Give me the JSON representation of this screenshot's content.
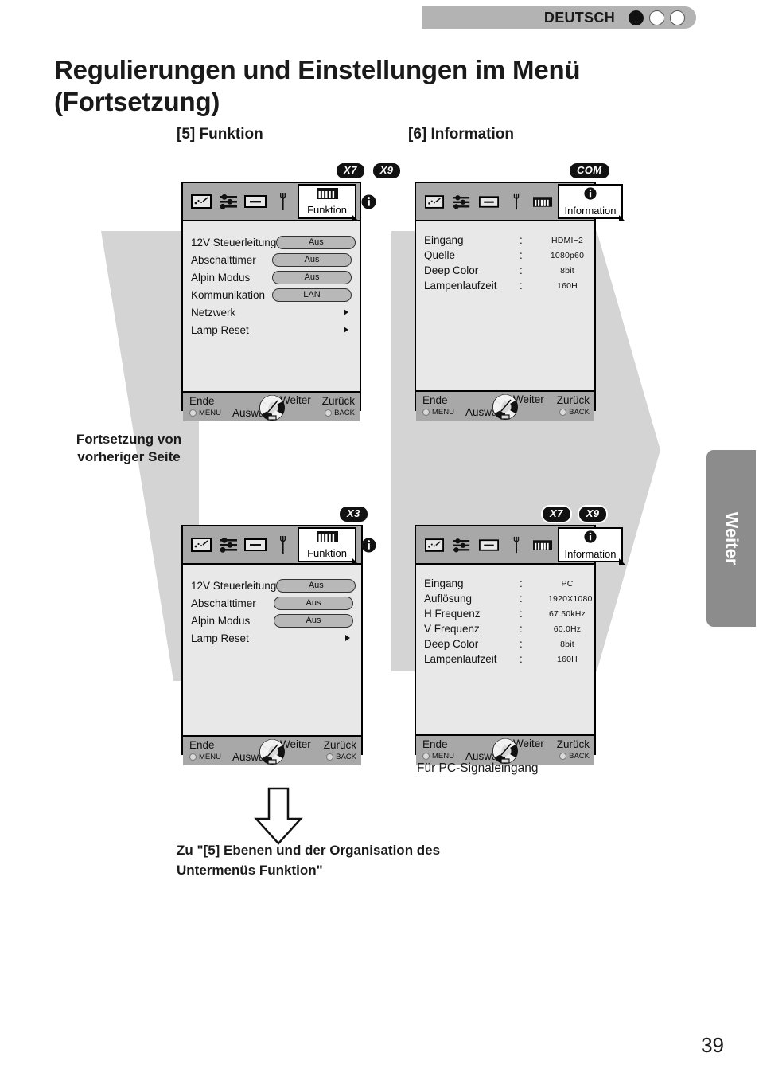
{
  "header": {
    "language": "DEUTSCH",
    "dots": [
      "filled",
      "hollow",
      "hollow"
    ]
  },
  "title": "Regulierungen und Einstellungen im Menü (Fortsetzung)",
  "sections": {
    "funktion_heading": "[5] Funktion",
    "information_heading": "[6] Information"
  },
  "badges": {
    "top_left": [
      "X7",
      "X9"
    ],
    "top_right": [
      "COM"
    ],
    "bottom_left": [
      "X3"
    ],
    "bottom_right": [
      "X7",
      "X9"
    ]
  },
  "tabbar": {
    "icons": [
      "picture-icon",
      "sliders-icon",
      "display-icon",
      "wrench-icon"
    ],
    "funktion_label": "Funktion",
    "information_label": "Information",
    "funktion_icon": "comb-icon",
    "information_icon": "info-circle-icon"
  },
  "footer": {
    "ende": "Ende",
    "menu": "MENU",
    "auswahl": "Auswahl",
    "weiter": "Weiter",
    "zurueck": "Zurück",
    "back": "BACK"
  },
  "osd_top_left": {
    "rows": [
      {
        "label": "12V Steuerleitung",
        "value": "Aus",
        "kind": "pill"
      },
      {
        "label": "Abschalttimer",
        "value": "Aus",
        "kind": "pill"
      },
      {
        "label": "Alpin Modus",
        "value": "Aus",
        "kind": "pill"
      },
      {
        "label": "Kommunikation",
        "value": "LAN",
        "kind": "pill"
      },
      {
        "label": "Netzwerk",
        "value": "",
        "kind": "arrow"
      },
      {
        "label": "Lamp Reset",
        "value": "",
        "kind": "arrow"
      }
    ]
  },
  "osd_bottom_left": {
    "rows": [
      {
        "label": "12V Steuerleitung",
        "value": "Aus",
        "kind": "pill"
      },
      {
        "label": "Abschalttimer",
        "value": "Aus",
        "kind": "pill"
      },
      {
        "label": "Alpin Modus",
        "value": "Aus",
        "kind": "pill"
      },
      {
        "label": "Lamp Reset",
        "value": "",
        "kind": "arrow"
      }
    ]
  },
  "osd_top_right": {
    "rows": [
      {
        "label": "Eingang",
        "colon": ":",
        "value": "HDMI−2"
      },
      {
        "label": "Quelle",
        "colon": ":",
        "value": "1080p60"
      },
      {
        "label": "Deep Color",
        "colon": ":",
        "value": "8bit"
      },
      {
        "label": "Lampenlaufzeit",
        "colon": ":",
        "value": "160H"
      }
    ]
  },
  "osd_bottom_right": {
    "rows": [
      {
        "label": "Eingang",
        "colon": ":",
        "value": "PC"
      },
      {
        "label": "Auflösung",
        "colon": ":",
        "value": "1920X1080"
      },
      {
        "label": "H Frequenz",
        "colon": ":",
        "value": "67.50kHz"
      },
      {
        "label": "V Frequenz",
        "colon": ":",
        "value": "60.0Hz"
      },
      {
        "label": "Deep Color",
        "colon": ":",
        "value": "8bit"
      },
      {
        "label": "Lampenlaufzeit",
        "colon": ":",
        "value": "160H"
      }
    ]
  },
  "continuation_text": "Fortsetzung von vorheriger Seite",
  "pc_caption": "Für PC-Signaleingang",
  "bottom_note": "Zu \"[5] Ebenen und der Organisation des Untermenüs Funktion\"",
  "side_tab_label": "Weiter",
  "page_number": "39",
  "colors": {
    "bg_shape": "#d4d4d4",
    "osd_body": "#e8e8e8",
    "osd_bar": "#a8a8a8",
    "pill": "#b8b8b8",
    "side_tab": "#8c8c8c",
    "lang_bar": "#b3b3b3"
  }
}
